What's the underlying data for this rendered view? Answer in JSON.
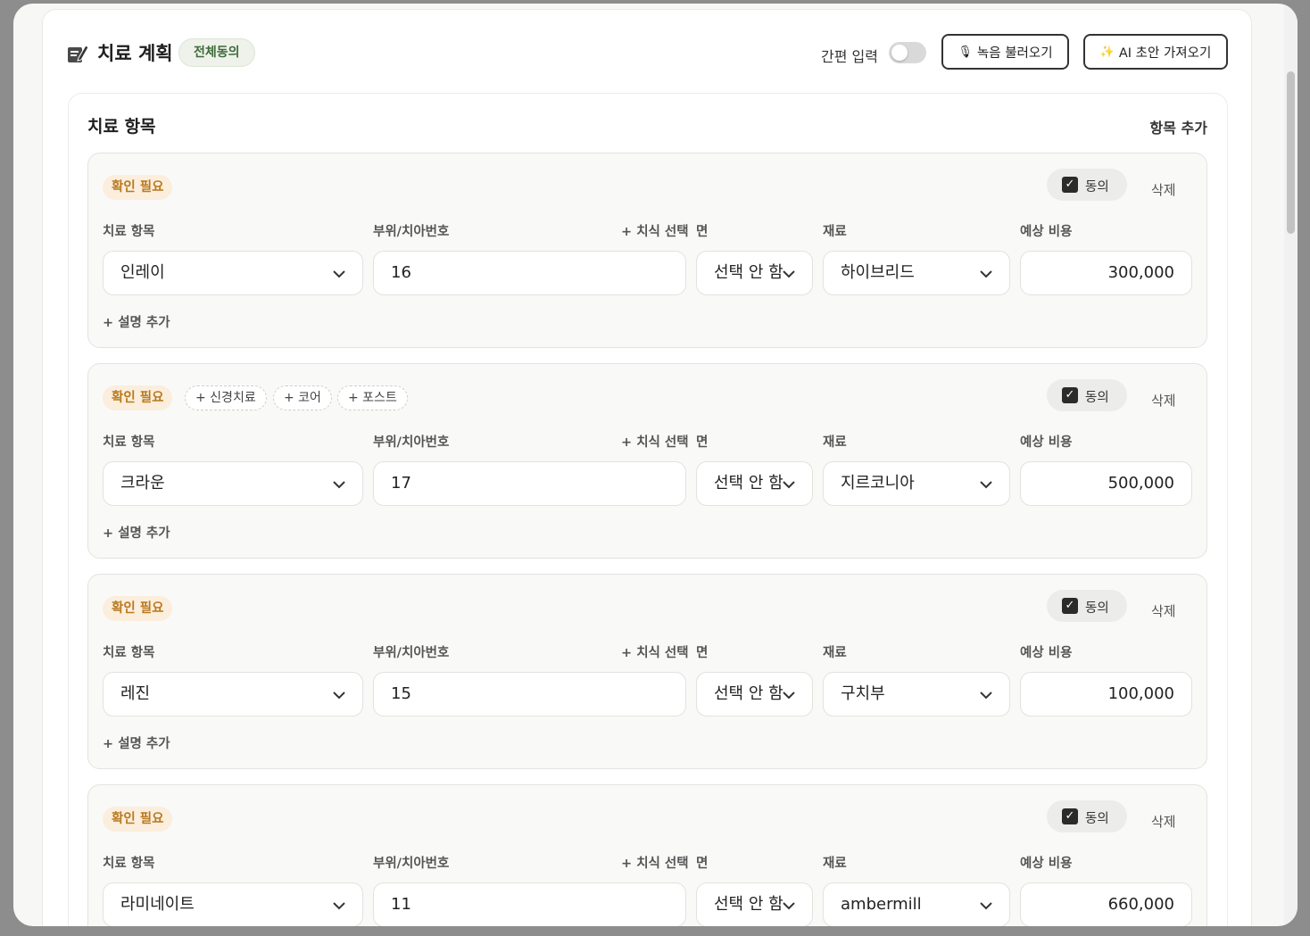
{
  "header": {
    "title": "치료 계획",
    "consent_badge": "전체동의",
    "quick_input_label": "간편 입력",
    "quick_input_on": false,
    "record_button": "녹음 불러오기",
    "ai_button": "AI 초안 가져오기"
  },
  "section": {
    "title": "치료 항목",
    "add_item": "항목 추가"
  },
  "labels": {
    "treatment": "치료 항목",
    "tooth": "부위/치아번호",
    "select_tooth": "+ 치식 선택",
    "surface": "면",
    "material": "재료",
    "cost": "예상 비용",
    "add_desc": "+ 설명 추가",
    "confirm": "확인 필요",
    "agree": "동의",
    "delete": "삭제"
  },
  "items": [
    {
      "treatment": "인레이",
      "tooth": "16",
      "surface": "선택 안 함",
      "material": "하이브리드",
      "cost": "300,000",
      "agreed": true,
      "chips": []
    },
    {
      "treatment": "크라운",
      "tooth": "17",
      "surface": "선택 안 함",
      "material": "지르코니아",
      "cost": "500,000",
      "agreed": true,
      "chips": [
        "+ 신경치료",
        "+ 코어",
        "+ 포스트"
      ]
    },
    {
      "treatment": "레진",
      "tooth": "15",
      "surface": "선택 안 함",
      "material": "구치부",
      "cost": "100,000",
      "agreed": true,
      "chips": []
    },
    {
      "treatment": "라미네이트",
      "tooth": "11",
      "surface": "선택 안 함",
      "material": "ambermill",
      "cost": "660,000",
      "agreed": true,
      "chips": []
    }
  ]
}
